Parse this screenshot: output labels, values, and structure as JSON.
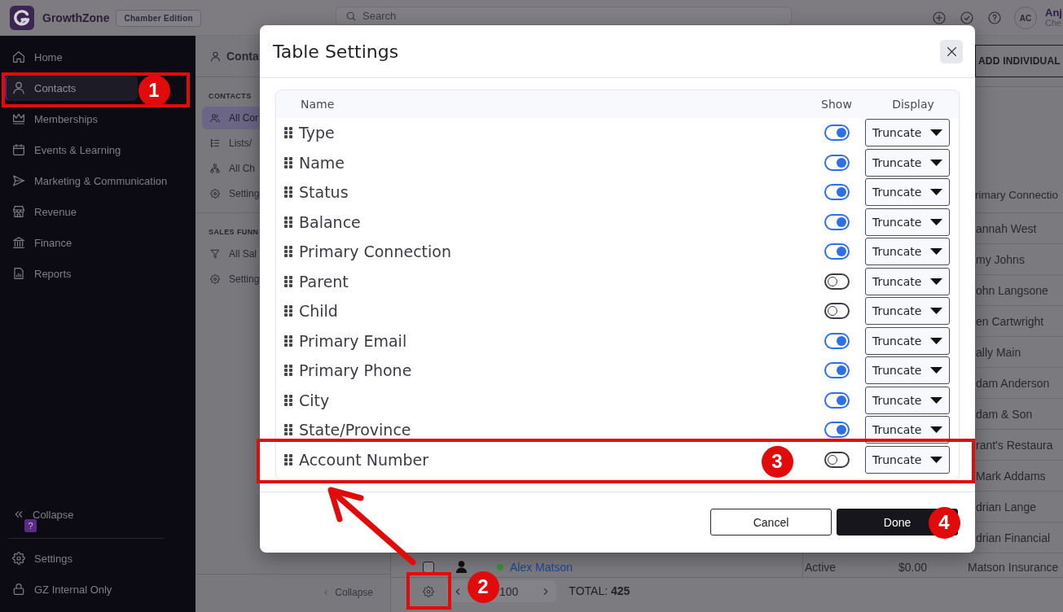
{
  "header": {
    "brand": "GrowthZone",
    "edition": "Chamber Edition",
    "search": {
      "placeholder": "Search"
    },
    "user": {
      "initials": "AC",
      "name": "Anj",
      "subtitle": "Che"
    }
  },
  "sidebar": {
    "items": [
      {
        "label": "Home",
        "selected": false
      },
      {
        "label": "Contacts",
        "selected": true
      },
      {
        "label": "Memberships",
        "selected": false
      },
      {
        "label": "Events & Learning",
        "selected": false
      },
      {
        "label": "Marketing & Communication",
        "selected": false
      },
      {
        "label": "Revenue",
        "selected": false
      },
      {
        "label": "Finance",
        "selected": false
      },
      {
        "label": "Reports",
        "selected": false
      }
    ],
    "collapse": "Collapse",
    "help_badge": "?",
    "footer_items": [
      {
        "label": "Settings"
      },
      {
        "label": "GZ Internal Only"
      }
    ]
  },
  "subnav": {
    "title": "Conta",
    "sections": [
      {
        "heading": "CONTACTS",
        "items": [
          {
            "label": "All Cor",
            "selected": true
          },
          {
            "label": "Lists/",
            "selected": false
          },
          {
            "label": "All Ch",
            "selected": false
          },
          {
            "label": "Setting",
            "selected": false
          }
        ]
      },
      {
        "heading": "SALES FUNN",
        "items": [
          {
            "label": "All Sal",
            "selected": false
          },
          {
            "label": "Setting",
            "selected": false
          }
        ]
      }
    ],
    "collapse": "Collapse"
  },
  "main": {
    "add_button": "ADD INDIVIDUAL",
    "table": {
      "column_header": "rimary Connectio",
      "rows": [
        {
          "primary_connection": "annah West"
        },
        {
          "primary_connection": "my Johns"
        },
        {
          "primary_connection": "ohn Langsone"
        },
        {
          "primary_connection": "en Cartwright"
        },
        {
          "primary_connection": "ally Main"
        },
        {
          "primary_connection": "dam Anderson"
        },
        {
          "primary_connection": "dam & Son"
        },
        {
          "primary_connection": "rant's Restaura"
        },
        {
          "primary_connection": "Mark Addams"
        },
        {
          "primary_connection": "drian Lange"
        },
        {
          "primary_connection": "drian Financial"
        },
        {
          "checked": false,
          "color": "#3c8c3c",
          "name": "Alex Matson",
          "status": "Active",
          "balance": "$0.00",
          "primary_connection": "Matson Insurance"
        }
      ]
    },
    "pager": {
      "range": "100",
      "total": "TOTAL: **425**"
    }
  },
  "modal": {
    "title": "Table Settings",
    "headers": {
      "name": "Name",
      "show": "Show",
      "display": "Display"
    },
    "rows": [
      {
        "name": "Type",
        "show": true,
        "display": "Truncate"
      },
      {
        "name": "Name",
        "show": true,
        "display": "Truncate"
      },
      {
        "name": "Status",
        "show": true,
        "display": "Truncate"
      },
      {
        "name": "Balance",
        "show": true,
        "display": "Truncate"
      },
      {
        "name": "Primary Connection",
        "show": true,
        "display": "Truncate"
      },
      {
        "name": "Parent",
        "show": false,
        "display": "Truncate"
      },
      {
        "name": "Child",
        "show": false,
        "display": "Truncate"
      },
      {
        "name": "Primary Email",
        "show": true,
        "display": "Truncate"
      },
      {
        "name": "Primary Phone",
        "show": true,
        "display": "Truncate"
      },
      {
        "name": "City",
        "show": true,
        "display": "Truncate"
      },
      {
        "name": "State/Province",
        "show": true,
        "display": "Truncate"
      },
      {
        "name": "Account Number",
        "show": false,
        "display": "Truncate"
      }
    ],
    "buttons": [
      {
        "label": "Cancel",
        "kind": "secondary"
      },
      {
        "label": "Done",
        "kind": "primary"
      }
    ]
  },
  "callouts": [
    {
      "label": "1"
    },
    {
      "label": "2"
    },
    {
      "label": "3"
    },
    {
      "label": "4"
    }
  ]
}
